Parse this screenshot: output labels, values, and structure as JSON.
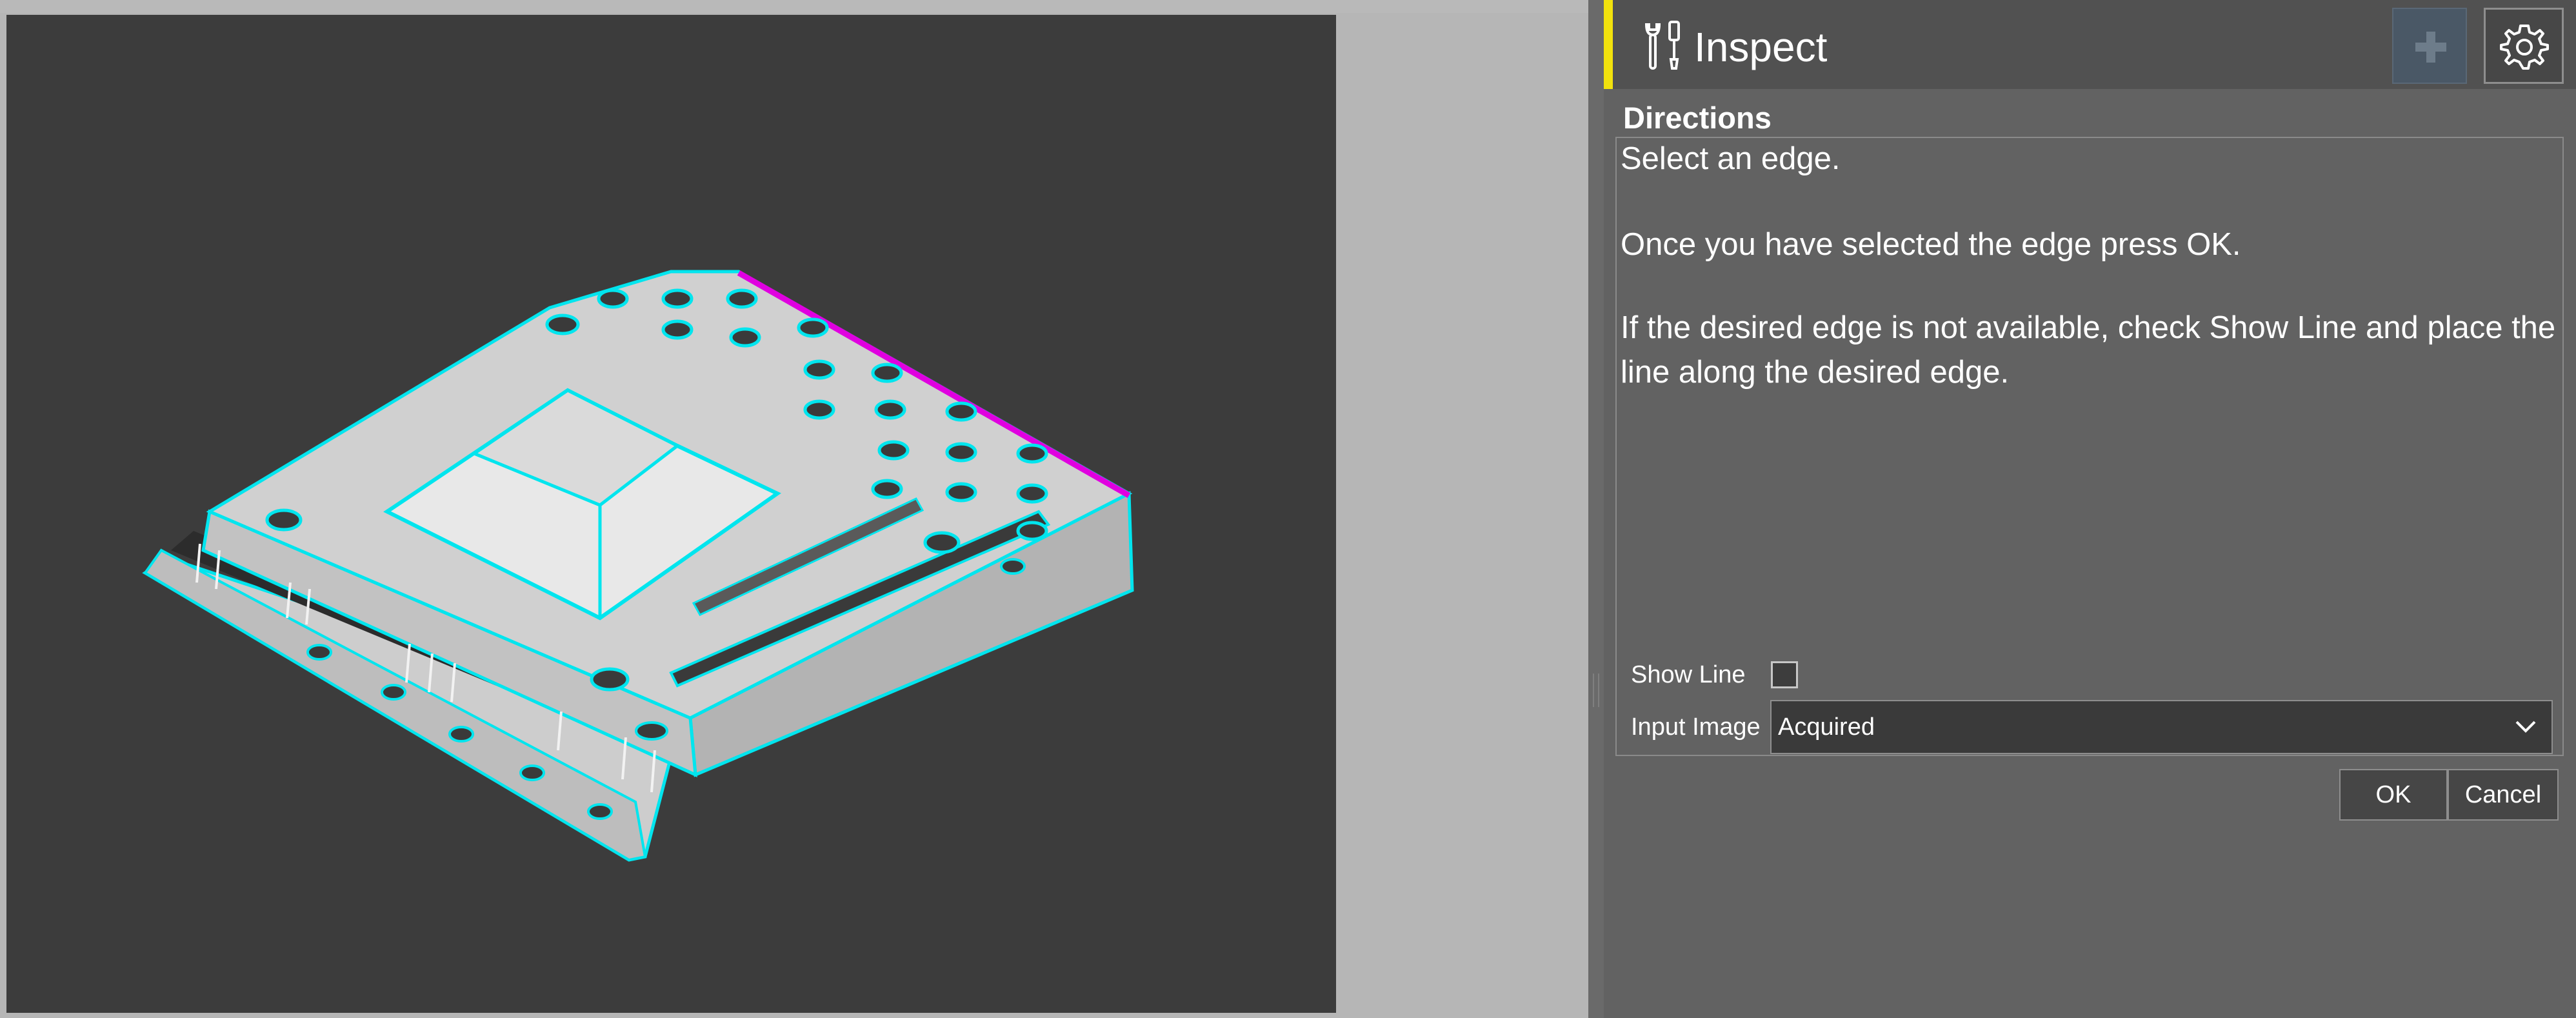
{
  "panel": {
    "title": "Inspect",
    "accent_color": "#f2e20d",
    "icons": {
      "title": "tools-icon",
      "add": "plus-icon",
      "settings": "gear-icon"
    }
  },
  "directions": {
    "heading": "Directions",
    "lines": [
      "Select an edge.",
      "Once you have selected the edge press OK.",
      "If the desired edge is not available, check Show Line and place the line along the desired edge."
    ]
  },
  "fields": {
    "show_line_label": "Show Line",
    "show_line_checked": false,
    "input_image_label": "Input Image",
    "input_image_value": "Acquired"
  },
  "buttons": {
    "ok": "OK",
    "cancel": "Cancel"
  },
  "viewer": {
    "highlight_color": "#00e5ee",
    "selected_edge_color": "#e000e0"
  }
}
